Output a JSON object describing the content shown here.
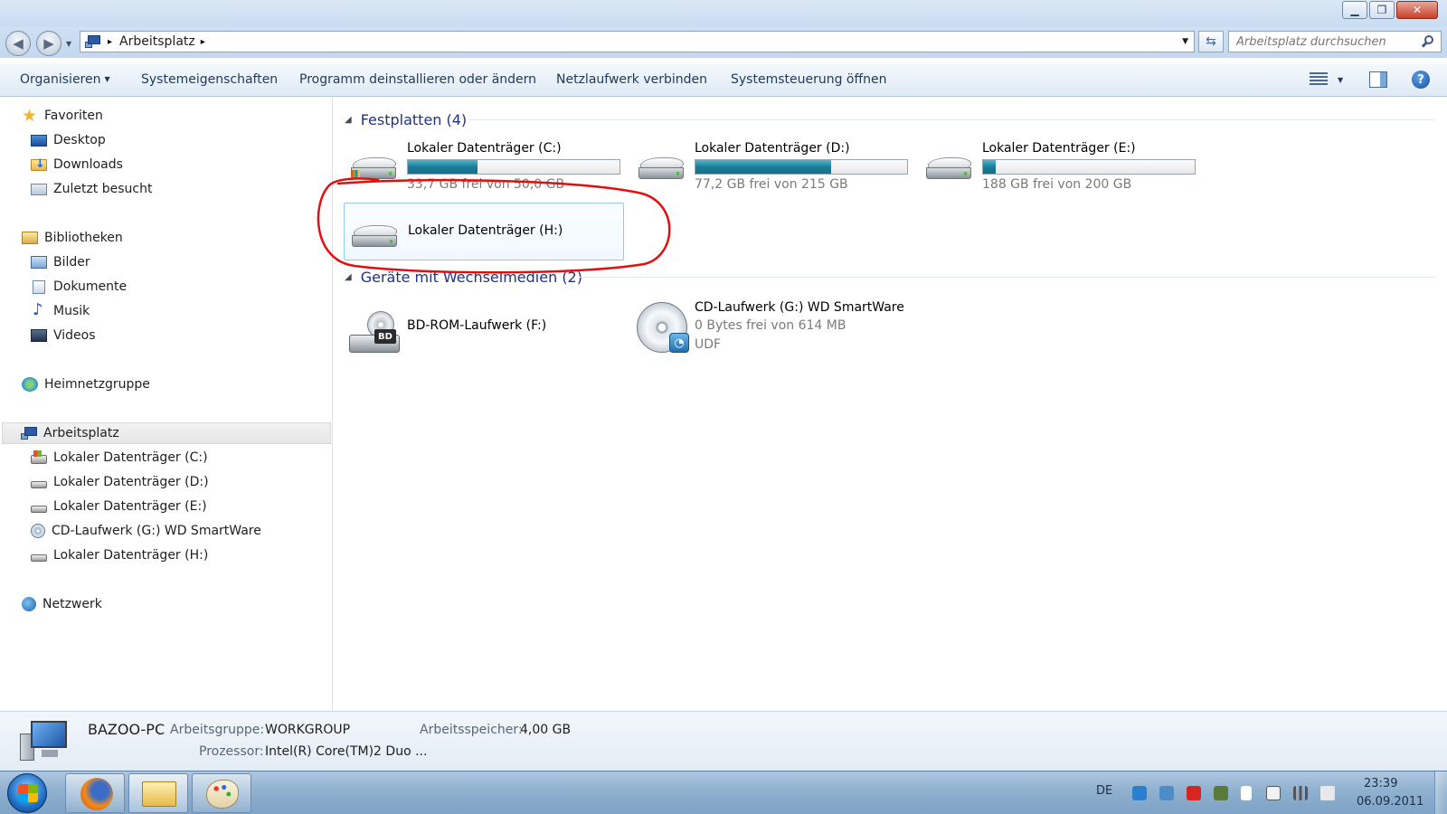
{
  "window": {
    "minimize_glyph": "▁",
    "maximize_glyph": "❐",
    "close_glyph": "✕"
  },
  "navigation": {
    "back_glyph": "◀",
    "forward_glyph": "▶",
    "breadcrumb": [
      "Arbeitsplatz"
    ],
    "crumb_separator": "▸",
    "dropdown_glyph": "▼",
    "refresh_glyph": "⇆",
    "search_placeholder": "Arbeitsplatz durchsuchen"
  },
  "toolbar": {
    "items": [
      {
        "label": "Organisieren",
        "has_dropdown": true
      },
      {
        "label": "Systemeigenschaften"
      },
      {
        "label": "Programm deinstallieren oder ändern"
      },
      {
        "label": "Netzlaufwerk verbinden"
      },
      {
        "label": "Systemsteuerung öffnen"
      }
    ],
    "dropdown_glyph": "▼",
    "help_glyph": "?"
  },
  "sidebar": {
    "favorites": {
      "label": "Favoriten",
      "items": [
        {
          "label": "Desktop",
          "icon": "desktop-icon"
        },
        {
          "label": "Downloads",
          "icon": "downloads-folder-icon"
        },
        {
          "label": "Zuletzt besucht",
          "icon": "recent-places-icon"
        }
      ]
    },
    "libraries": {
      "label": "Bibliotheken",
      "items": [
        {
          "label": "Bilder",
          "icon": "pictures-icon"
        },
        {
          "label": "Dokumente",
          "icon": "documents-icon"
        },
        {
          "label": "Musik",
          "icon": "music-icon"
        },
        {
          "label": "Videos",
          "icon": "videos-icon"
        }
      ]
    },
    "homegroup": {
      "label": "Heimnetzgruppe"
    },
    "computer": {
      "label": "Arbeitsplatz",
      "selected": true,
      "items": [
        {
          "label": "Lokaler Datenträger (C:)",
          "icon": "system-drive-icon"
        },
        {
          "label": "Lokaler Datenträger  (D:)",
          "icon": "drive-icon"
        },
        {
          "label": "Lokaler Datenträger (E:)",
          "icon": "drive-icon"
        },
        {
          "label": "CD-Laufwerk (G:) WD SmartWare",
          "icon": "cd-drive-icon"
        },
        {
          "label": "Lokaler Datenträger (H:)",
          "icon": "drive-icon"
        }
      ]
    },
    "network": {
      "label": "Netzwerk"
    }
  },
  "content": {
    "groups": [
      {
        "title": "Festplatten (4)",
        "collapse_glyph": "◢",
        "items": [
          {
            "name": "Lokaler Datenträger (C:)",
            "free_text": "33,7 GB frei von 50,0 GB",
            "used_fraction": 0.33
          },
          {
            "name": "Lokaler Datenträger  (D:)",
            "free_text": "77,2 GB frei von 215 GB",
            "used_fraction": 0.64
          },
          {
            "name": "Lokaler Datenträger (E:)",
            "free_text": "188 GB frei von 200 GB",
            "used_fraction": 0.06
          },
          {
            "name": "Lokaler Datenträger (H:)",
            "selected": true
          }
        ]
      },
      {
        "title": "Geräte mit Wechselmedien (2)",
        "collapse_glyph": "◢",
        "items": [
          {
            "name": "BD-ROM-Laufwerk (F:)",
            "badge": "BD"
          },
          {
            "name": "CD-Laufwerk (G:) WD SmartWare",
            "line2": "0 Bytes frei von 614 MB",
            "line3": "UDF"
          }
        ]
      }
    ],
    "annotation_color": "#e01010"
  },
  "details": {
    "computer_name": "BAZOO-PC",
    "workgroup_label": "Arbeitsgruppe:",
    "workgroup_value": "WORKGROUP",
    "memory_label": "Arbeitsspeicher:",
    "memory_value": "4,00 GB",
    "processor_label": "Prozessor:",
    "processor_value": "Intel(R) Core(TM)2 Duo ..."
  },
  "taskbar": {
    "apps": [
      {
        "name": "firefox",
        "icon": "firefox-icon"
      },
      {
        "name": "explorer",
        "icon": "explorer-folder-icon",
        "active": true
      },
      {
        "name": "paint",
        "icon": "paint-icon"
      }
    ],
    "language": "DE",
    "time": "23:39",
    "date": "06.09.2011"
  }
}
